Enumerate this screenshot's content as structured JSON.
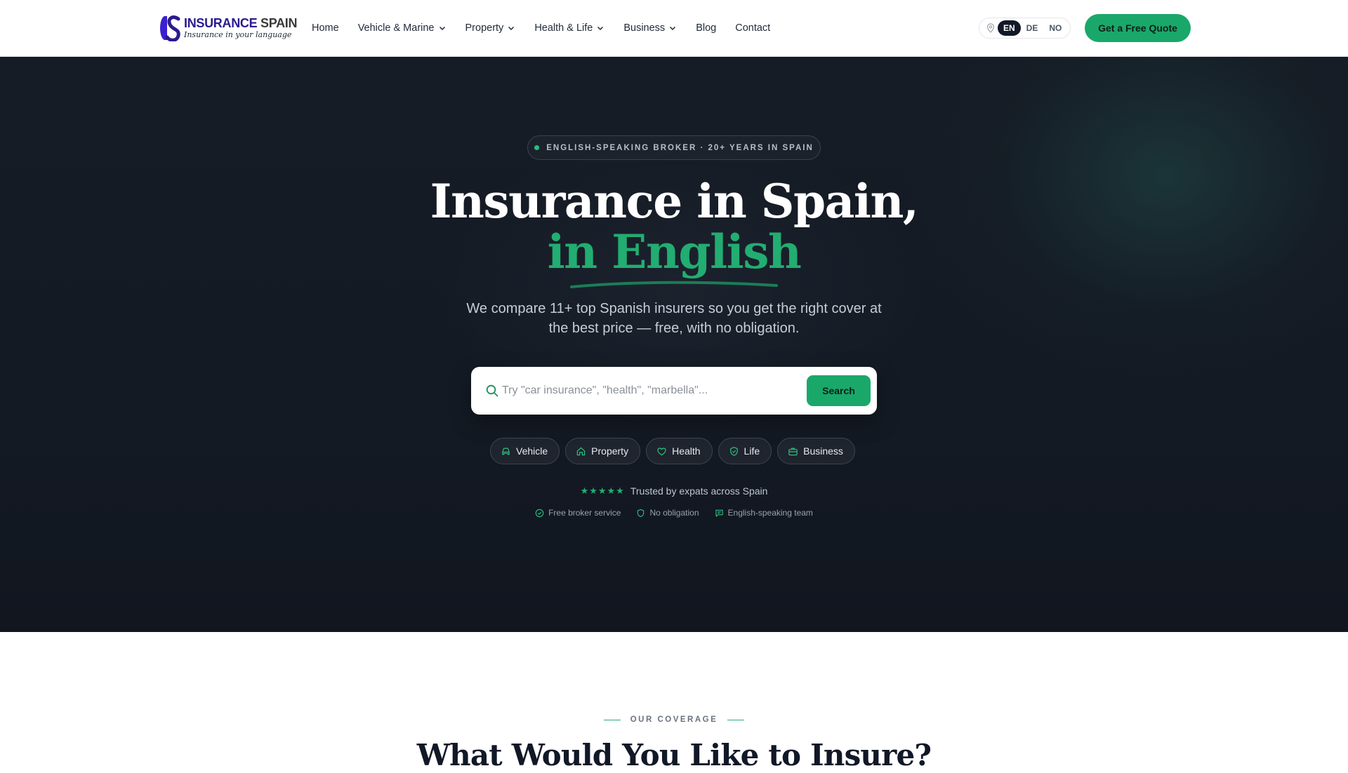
{
  "brand": {
    "name_part1": "INSURANCE",
    "name_part2": "SPAIN",
    "tagline": "Insurance in your language",
    "primary_color": "#2b1a8f",
    "accent_color": "#1aa86a"
  },
  "nav": {
    "items": [
      {
        "label": "Home",
        "dropdown": false
      },
      {
        "label": "Vehicle & Marine",
        "dropdown": true
      },
      {
        "label": "Property",
        "dropdown": true
      },
      {
        "label": "Health & Life",
        "dropdown": true
      },
      {
        "label": "Business",
        "dropdown": true
      },
      {
        "label": "Blog",
        "dropdown": false
      },
      {
        "label": "Contact",
        "dropdown": false
      }
    ],
    "languages": [
      "EN",
      "DE",
      "NO"
    ],
    "active_language": "EN",
    "cta_label": "Get a Free Quote"
  },
  "hero": {
    "badge": "ENGLISH-SPEAKING BROKER · 20+ YEARS IN SPAIN",
    "title_line1": "Insurance in Spain,",
    "title_line2": "in English",
    "subtitle": "We compare 11+ top Spanish insurers so you get the right cover at the best price — free, with no obligation.",
    "search_placeholder": "Try \"car insurance\", \"health\", \"marbella\"...",
    "search_button": "Search",
    "chips": [
      {
        "label": "Vehicle",
        "icon": "car-icon"
      },
      {
        "label": "Property",
        "icon": "home-icon"
      },
      {
        "label": "Health",
        "icon": "heart-icon"
      },
      {
        "label": "Life",
        "icon": "shield-check-icon"
      },
      {
        "label": "Business",
        "icon": "briefcase-icon"
      }
    ],
    "stars": "★★★★★",
    "trust_text": "Trusted by expats across Spain",
    "perks": [
      {
        "label": "Free broker service",
        "icon": "check-circle-icon"
      },
      {
        "label": "No obligation",
        "icon": "shield-icon"
      },
      {
        "label": "English-speaking team",
        "icon": "chat-icon"
      }
    ]
  },
  "coverage": {
    "eyebrow": "OUR COVERAGE",
    "title": "What Would You Like to Insure?"
  }
}
